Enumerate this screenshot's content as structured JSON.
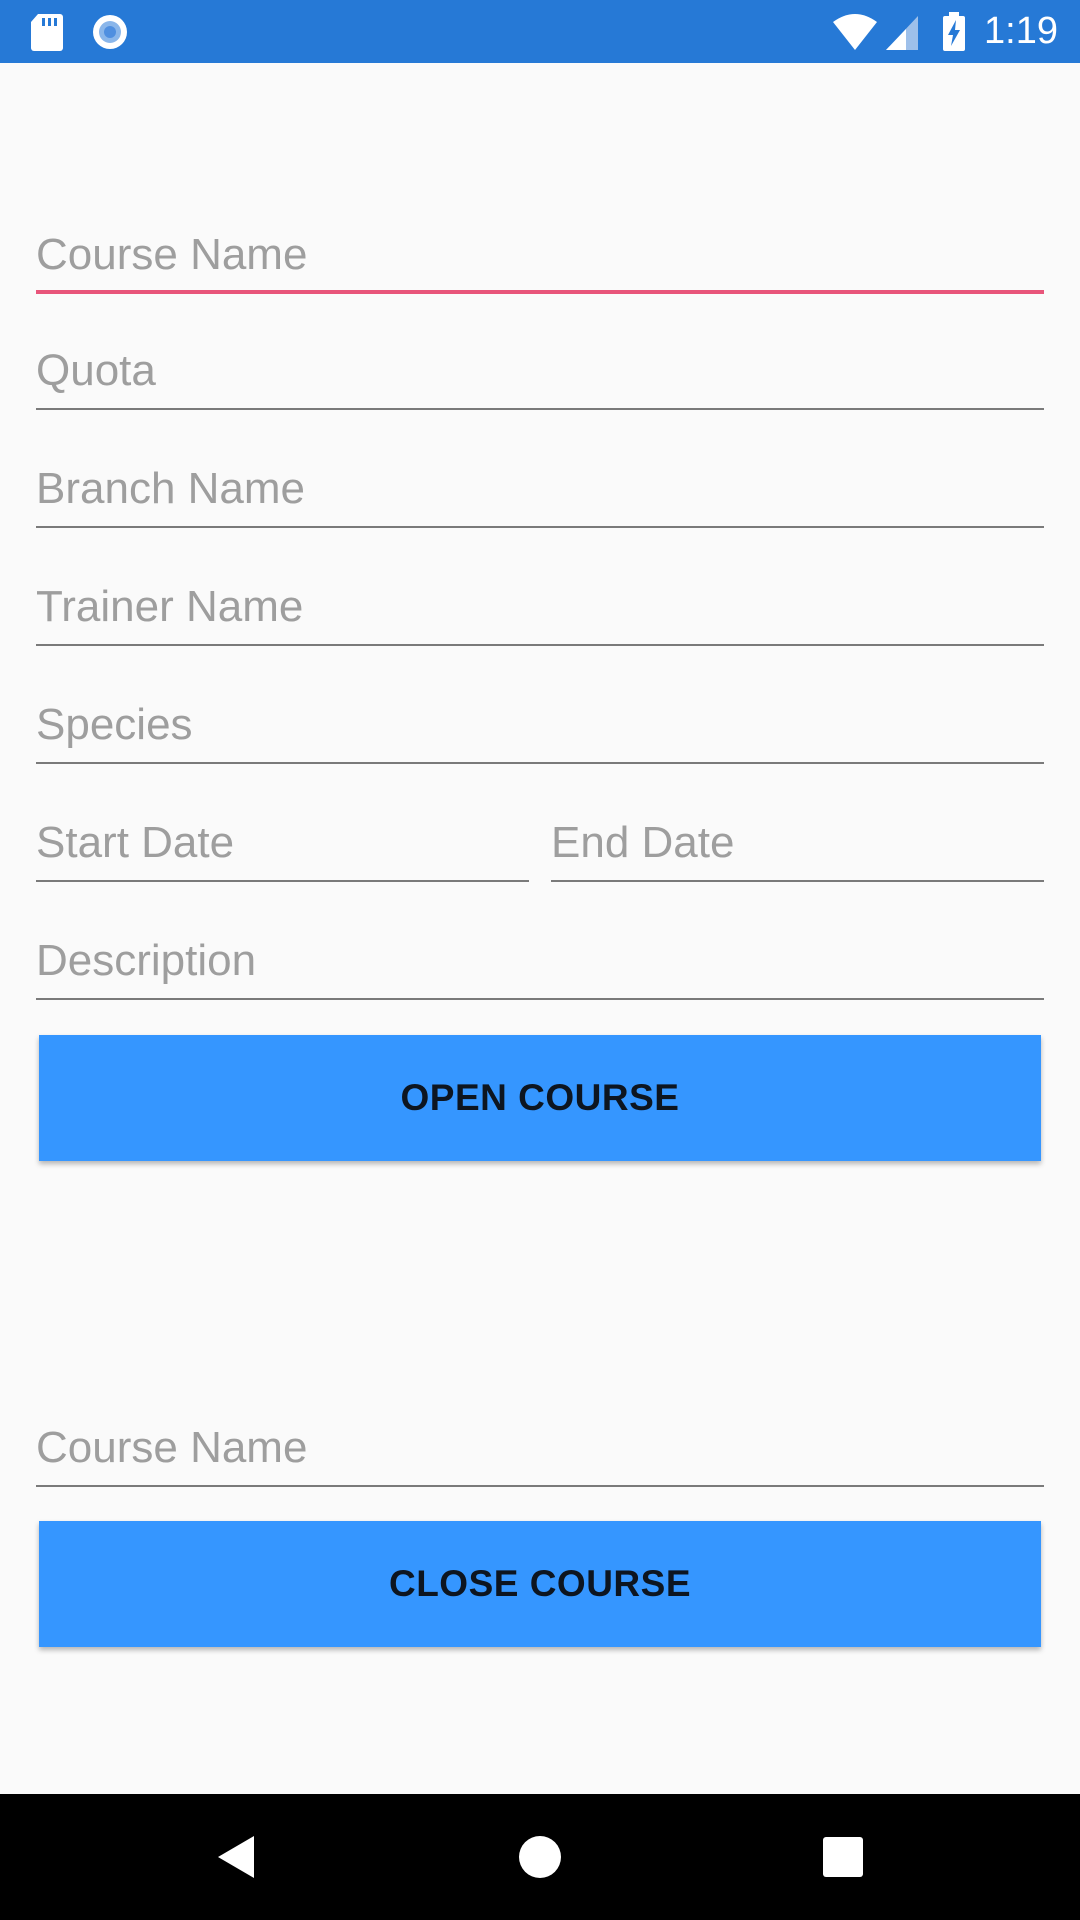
{
  "status_bar": {
    "time": "1:19",
    "left_icons": [
      "sd-card-icon",
      "record-circle-icon"
    ],
    "right_icons": [
      "wifi-icon",
      "cell-signal-icon",
      "battery-charging-icon"
    ],
    "background_color": "#2679d6"
  },
  "open_form": {
    "course_name_placeholder": "Course Name",
    "quota_placeholder": "Quota",
    "branch_name_placeholder": "Branch Name",
    "trainer_name_placeholder": "Trainer Name",
    "species_placeholder": "Species",
    "start_date_placeholder": "Start Date",
    "end_date_placeholder": "End Date",
    "description_placeholder": "Description",
    "open_button_label": "OPEN COURSE"
  },
  "close_form": {
    "course_name_placeholder": "Course Name",
    "close_button_label": "CLOSE COURSE"
  },
  "nav_bar": {
    "icons": [
      "back-icon",
      "home-icon",
      "recents-icon"
    ]
  },
  "colors": {
    "accent_focus": "#e8557a",
    "button": "#3596ff",
    "placeholder": "#9e9e9e"
  }
}
